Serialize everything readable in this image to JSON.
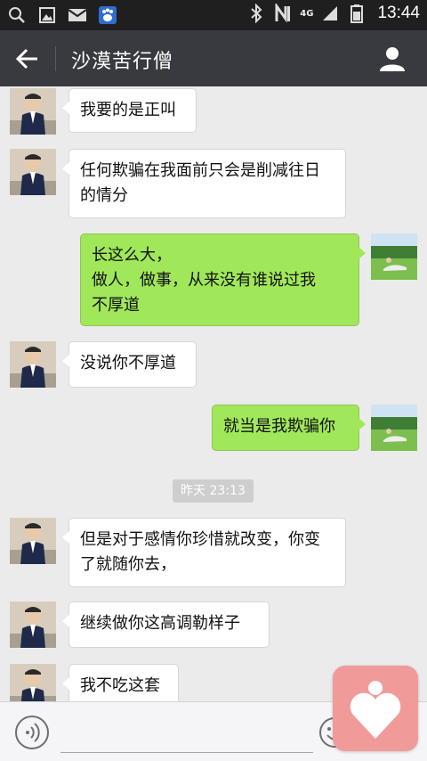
{
  "status_bar": {
    "time": "13:44",
    "network": "4G",
    "left_icons": [
      "search-icon",
      "gallery-icon",
      "mail-icon",
      "baidu-paw-icon"
    ],
    "right_icons": [
      "bluetooth-icon",
      "nfc-icon",
      "signal-icon",
      "battery-icon"
    ]
  },
  "header": {
    "title": "沙漠苦行僧",
    "back_icon": "arrow-left-icon",
    "profile_icon": "person-icon"
  },
  "messages": [
    {
      "from": "them",
      "text": "我要的是正叫"
    },
    {
      "from": "them",
      "text": "任何欺骗在我面前只会是削减往日的情分"
    },
    {
      "from": "me",
      "lines": [
        "长这么大，",
        "做人，做事，从来没有谁说过我",
        "不厚道"
      ]
    },
    {
      "from": "them",
      "text": "没说你不厚道"
    },
    {
      "from": "me",
      "text": "就当是我欺骗你"
    },
    {
      "type": "timestamp",
      "text": "昨天 23:13"
    },
    {
      "from": "them",
      "text": "但是对于感情你珍惜就改变，你变了就随你去，"
    },
    {
      "from": "them",
      "text": "继续做你这高调勒样子"
    },
    {
      "from": "them",
      "text": "我不吃这套"
    }
  ],
  "input_bar": {
    "voice_icon": "voice-icon",
    "emoji_icon": "emoji-icon",
    "text_value": ""
  },
  "floating_button": {
    "icon": "heart-person-icon"
  },
  "colors": {
    "status_bar": "#1f1f1f",
    "title_bar": "#393a3f",
    "chat_background": "#ebebeb",
    "outgoing_bubble": "#a0e75a",
    "incoming_bubble": "#ffffff",
    "floating_button": "#f19a9a"
  }
}
